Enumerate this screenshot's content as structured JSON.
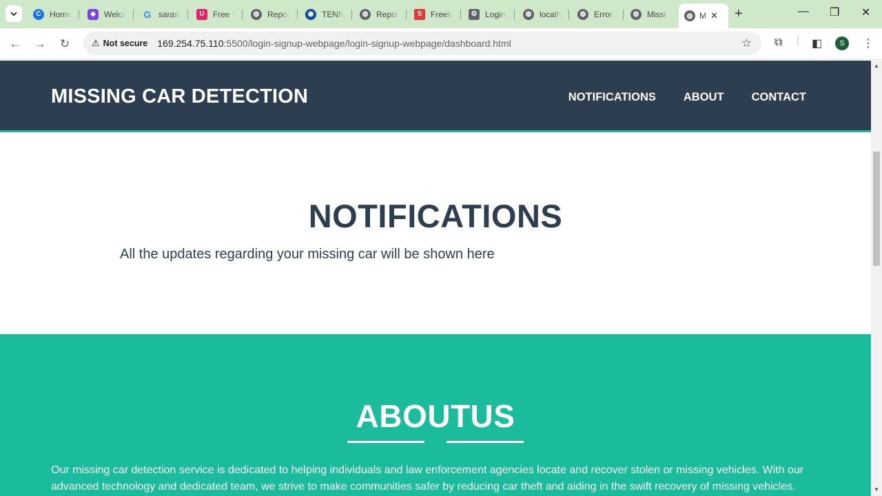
{
  "browser": {
    "tabs": [
      {
        "title": "Home",
        "fav_color": "#1a73e8",
        "fav_icon": "c-logo-icon"
      },
      {
        "title": "Welco",
        "fav_color": "#7b3fe4",
        "fav_icon": "shield-icon"
      },
      {
        "title": "sarasv",
        "fav_color": "#ffffff",
        "fav_icon": "google-icon"
      },
      {
        "title": "Free Y",
        "fav_color": "#e91e63",
        "fav_icon": "u-logo-icon"
      },
      {
        "title": "Repor",
        "fav_color": "#5f6368",
        "fav_icon": "globe-icon"
      },
      {
        "title": "TENN",
        "fav_color": "#1565c0",
        "fav_icon": "ring-icon"
      },
      {
        "title": "Repor",
        "fav_color": "#5f6368",
        "fav_icon": "globe-icon"
      },
      {
        "title": "Freela",
        "fav_color": "#e53935",
        "fav_icon": "s-logo-icon"
      },
      {
        "title": "Login",
        "fav_color": "#5f6368",
        "fav_icon": "gear-icon"
      },
      {
        "title": "localh",
        "fav_color": "#5f6368",
        "fav_icon": "globe-icon"
      },
      {
        "title": "Error",
        "fav_color": "#5f6368",
        "fav_icon": "globe-icon"
      },
      {
        "title": "Missi",
        "fav_color": "#5f6368",
        "fav_icon": "globe-icon"
      },
      {
        "title": "M",
        "fav_color": "#5f6368",
        "fav_icon": "globe-icon"
      }
    ],
    "security_label": "Not secure",
    "url_host": "169.254.75.110",
    "url_rest": ":5500/login-signup-webpage/login-signup-webpage/dashboard.html",
    "profile_initial": "S"
  },
  "site": {
    "brand": "MISSING CAR DETECTION",
    "nav": [
      "NOTIFICATIONS",
      "ABOUT",
      "CONTACT"
    ],
    "notifications": {
      "heading": "NOTIFICATIONS",
      "text": "All the updates regarding your missing car will be shown here"
    },
    "about": {
      "heading": "ABOUTUS",
      "text": "Our missing car detection service is dedicated to helping individuals and law enforcement agencies locate and recover stolen or missing vehicles. With our advanced technology and dedicated team, we strive to make communities safer by reducing car theft and aiding in the swift recovery of missing vehicles."
    },
    "colors": {
      "header": "#2c3e50",
      "accent": "#1abc9c",
      "text_dark": "#2c3e50"
    }
  }
}
